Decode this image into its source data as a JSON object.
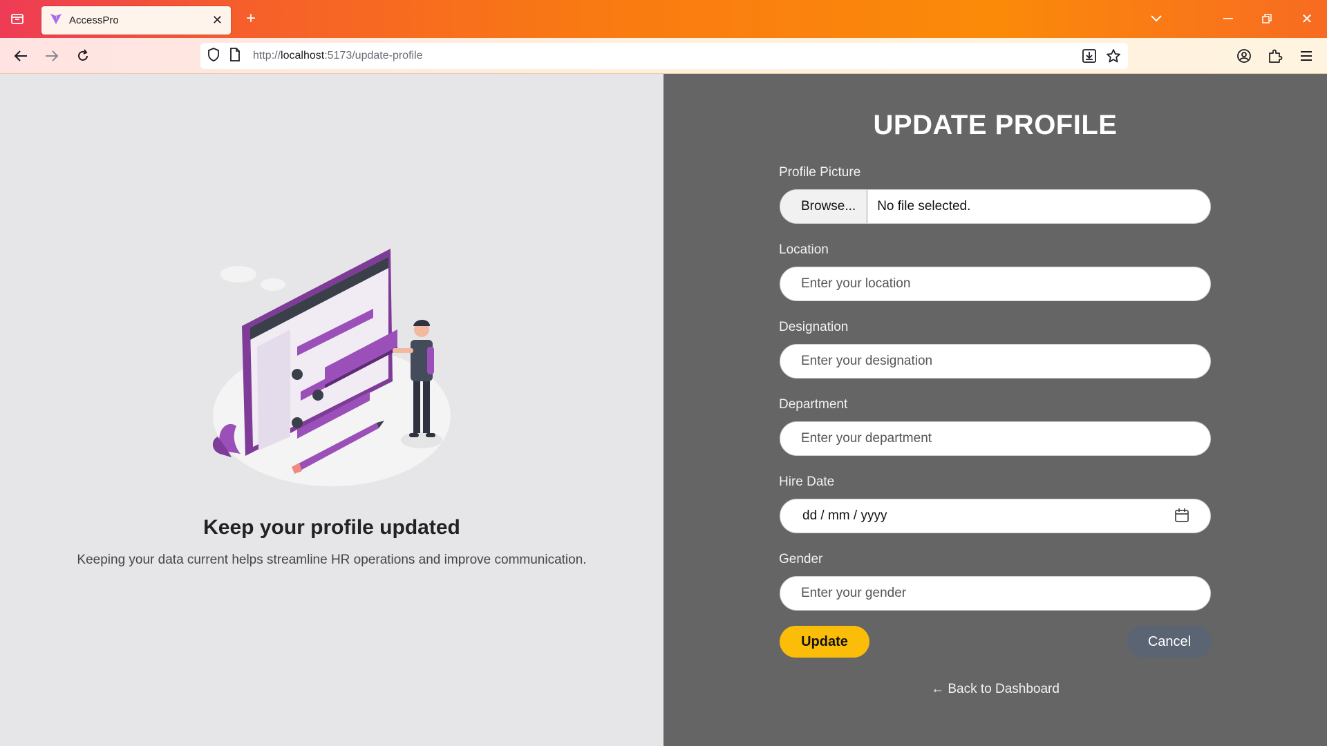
{
  "browser": {
    "tab_title": "AccessPro",
    "url_prefix": "http://",
    "url_host": "localhost",
    "url_rest": ":5173/update-profile"
  },
  "left": {
    "heading": "Keep your profile updated",
    "subheading": "Keeping your data current helps streamline HR operations and improve communication."
  },
  "form": {
    "title": "UPDATE PROFILE",
    "profile_picture_label": "Profile Picture",
    "browse_label": "Browse...",
    "file_status": "No file selected.",
    "location_label": "Location",
    "location_placeholder": "Enter your location",
    "designation_label": "Designation",
    "designation_placeholder": "Enter your designation",
    "department_label": "Department",
    "department_placeholder": "Enter your department",
    "hire_date_label": "Hire Date",
    "hire_date_value": "dd / mm / yyyy",
    "gender_label": "Gender",
    "gender_placeholder": "Enter your gender",
    "update_label": "Update",
    "cancel_label": "Cancel",
    "back_link": "← Back to Dashboard"
  },
  "colors": {
    "accent": "#fbbd08",
    "panel": "#656565",
    "cancel": "#5a6472",
    "illustration": "#9b4fb8"
  }
}
